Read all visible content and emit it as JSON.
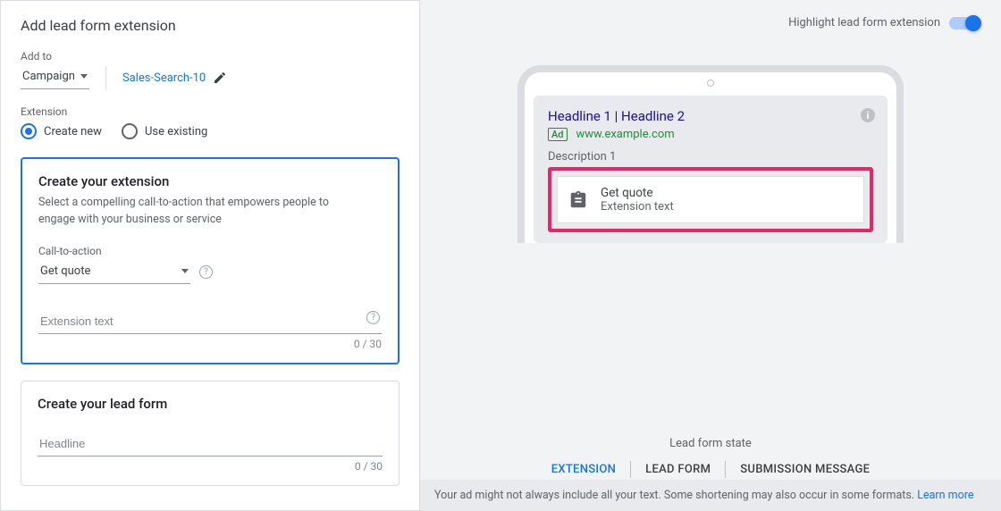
{
  "page_title": "Add lead form extension",
  "add_to": {
    "label": "Add to",
    "level": "Campaign",
    "campaign_name": "Sales-Search-10"
  },
  "extension_section": {
    "label": "Extension",
    "create_new_label": "Create new",
    "use_existing_label": "Use existing",
    "selected": "create_new"
  },
  "create_extension": {
    "title": "Create your extension",
    "description": "Select a compelling call-to-action that empowers people to engage with your business or service",
    "cta_label": "Call-to-action",
    "cta_value": "Get quote",
    "extension_text_placeholder": "Extension text",
    "extension_text_value": "",
    "extension_text_counter": "0 / 30"
  },
  "create_lead_form": {
    "title": "Create your lead form",
    "headline_placeholder": "Headline",
    "headline_value": "",
    "headline_counter": "0 / 30"
  },
  "preview": {
    "highlight_label": "Highlight lead form extension",
    "highlight_on": true,
    "headline": "Headline 1 | Headline 2",
    "ad_badge": "Ad",
    "url": "www.example.com",
    "description": "Description 1",
    "ext_cta": "Get quote",
    "ext_text": "Extension text",
    "state_label": "Lead form state",
    "tabs": {
      "extension": "EXTENSION",
      "lead_form": "LEAD FORM",
      "submission": "SUBMISSION MESSAGE"
    },
    "footnote": "Your ad might not always include all your text. Some shortening may also occur in some formats.",
    "learn_more": "Learn more"
  }
}
